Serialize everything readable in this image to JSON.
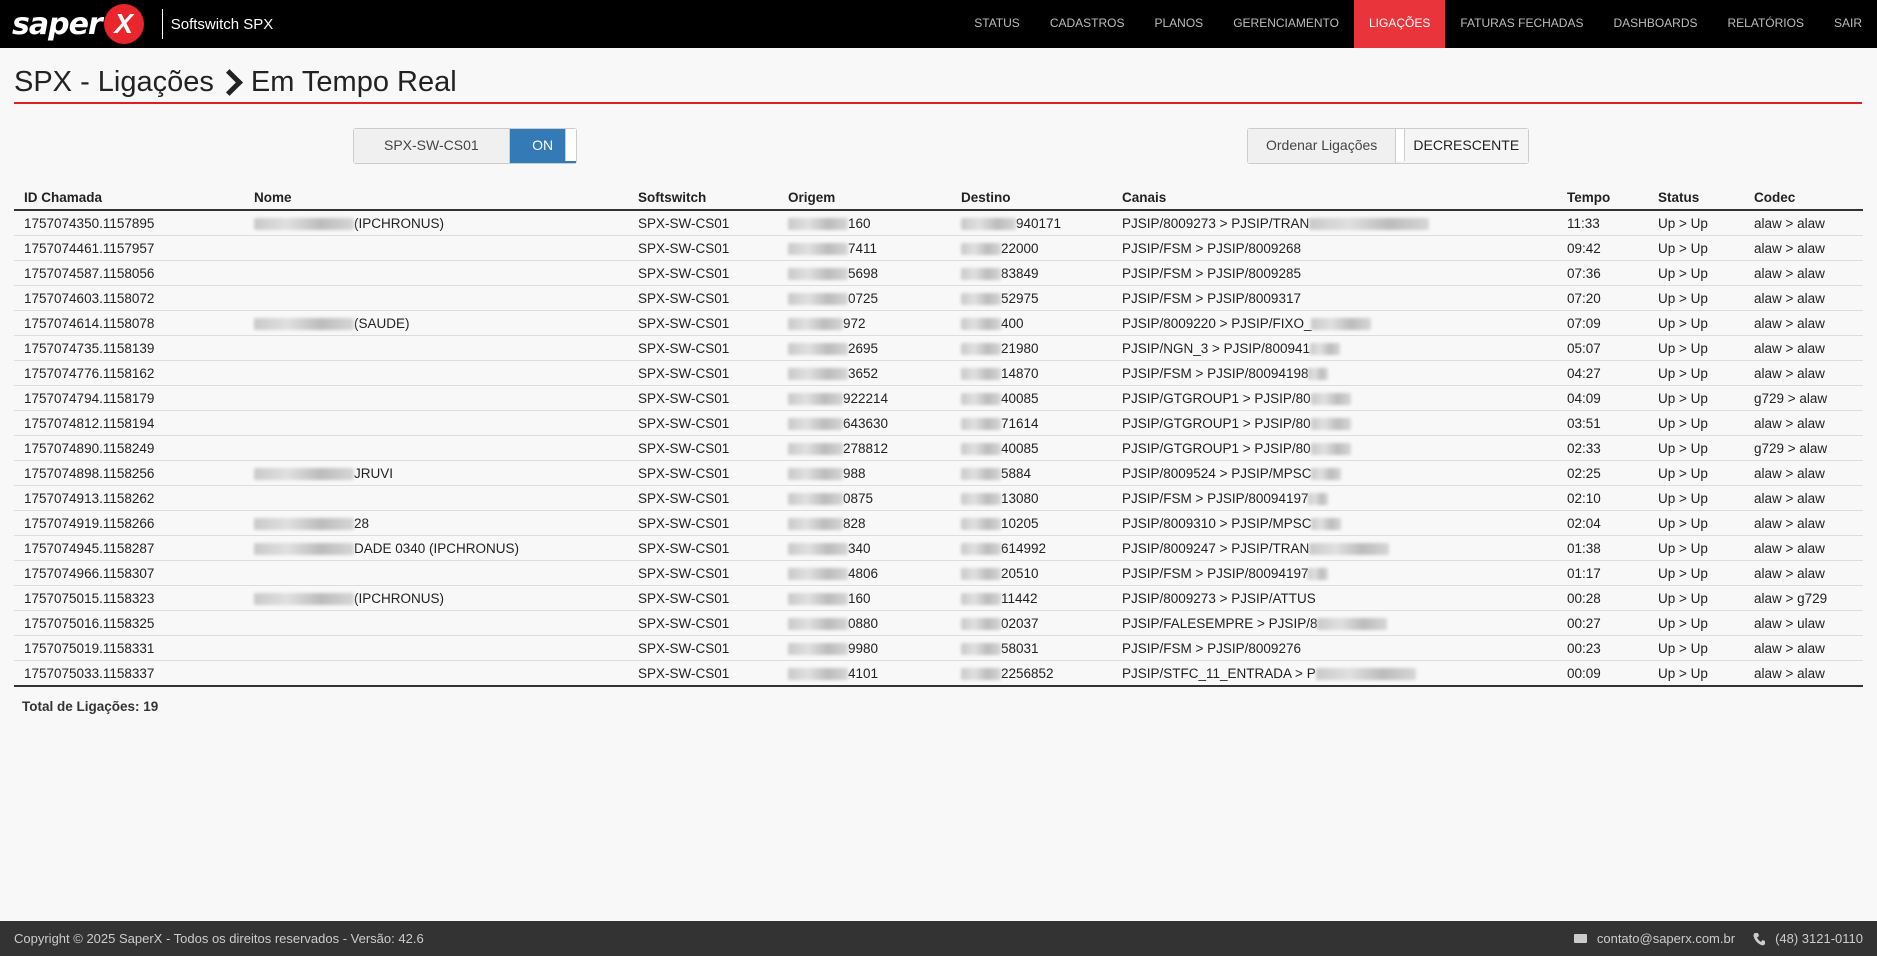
{
  "brand": {
    "logo_text": "saper",
    "logo_x": "X",
    "app_name": "Softswitch SPX"
  },
  "nav": [
    {
      "label": "STATUS"
    },
    {
      "label": "CADASTROS"
    },
    {
      "label": "PLANOS"
    },
    {
      "label": "GERENCIAMENTO"
    },
    {
      "label": "LIGAÇÕES",
      "active": true
    },
    {
      "label": "FATURAS FECHADAS"
    },
    {
      "label": "DASHBOARDS"
    },
    {
      "label": "RELATÓRIOS"
    },
    {
      "label": "SAIR"
    }
  ],
  "page": {
    "title_part1": "SPX - Ligações",
    "title_part2": "Em Tempo Real"
  },
  "switch_toggle": {
    "label": "SPX-SW-CS01",
    "state": "ON"
  },
  "order_toggle": {
    "label": "Ordenar Ligações",
    "value": "DECRESCENTE"
  },
  "table": {
    "headers": [
      "ID Chamada",
      "Nome",
      "Softswitch",
      "Origem",
      "Destino",
      "Canais",
      "Tempo",
      "Status",
      "Codec"
    ],
    "rows": [
      {
        "id": "1757074350.1157895",
        "nome": "(IPCHRONUS)",
        "nome_blur": 100,
        "soft": "SPX-SW-CS01",
        "origem": "160",
        "orig_blur": 60,
        "destino": "940171",
        "dest_blur": 55,
        "canais": "PJSIP/8009273 > PJSIP/TRAN",
        "can_blur": 120,
        "tempo": "11:33",
        "status": "Up > Up",
        "codec": "alaw > alaw"
      },
      {
        "id": "1757074461.1157957",
        "nome": "",
        "nome_blur": 0,
        "soft": "SPX-SW-CS01",
        "origem": "7411",
        "orig_blur": 60,
        "destino": "22000",
        "dest_blur": 40,
        "canais": "PJSIP/FSM > PJSIP/8009268",
        "can_blur": 0,
        "tempo": "09:42",
        "status": "Up > Up",
        "codec": "alaw > alaw"
      },
      {
        "id": "1757074587.1158056",
        "nome": "",
        "nome_blur": 0,
        "soft": "SPX-SW-CS01",
        "origem": "5698",
        "orig_blur": 60,
        "destino": "83849",
        "dest_blur": 40,
        "canais": "PJSIP/FSM > PJSIP/8009285",
        "can_blur": 0,
        "tempo": "07:36",
        "status": "Up > Up",
        "codec": "alaw > alaw"
      },
      {
        "id": "1757074603.1158072",
        "nome": "",
        "nome_blur": 0,
        "soft": "SPX-SW-CS01",
        "origem": "0725",
        "orig_blur": 60,
        "destino": "52975",
        "dest_blur": 40,
        "canais": "PJSIP/FSM > PJSIP/8009317",
        "can_blur": 0,
        "tempo": "07:20",
        "status": "Up > Up",
        "codec": "alaw > alaw"
      },
      {
        "id": "1757074614.1158078",
        "nome": "(SAUDE)",
        "nome_blur": 100,
        "soft": "SPX-SW-CS01",
        "origem": "972",
        "orig_blur": 55,
        "destino": "400",
        "dest_blur": 40,
        "canais": "PJSIP/8009220 > PJSIP/FIXO_",
        "can_blur": 60,
        "tempo": "07:09",
        "status": "Up > Up",
        "codec": "alaw > alaw"
      },
      {
        "id": "1757074735.1158139",
        "nome": "",
        "nome_blur": 0,
        "soft": "SPX-SW-CS01",
        "origem": "2695",
        "orig_blur": 60,
        "destino": "21980",
        "dest_blur": 40,
        "canais": "PJSIP/NGN_3 > PJSIP/800941",
        "can_blur": 30,
        "tempo": "05:07",
        "status": "Up > Up",
        "codec": "alaw > alaw"
      },
      {
        "id": "1757074776.1158162",
        "nome": "",
        "nome_blur": 0,
        "soft": "SPX-SW-CS01",
        "origem": "3652",
        "orig_blur": 60,
        "destino": "14870",
        "dest_blur": 40,
        "canais": "PJSIP/FSM > PJSIP/80094198",
        "can_blur": 20,
        "tempo": "04:27",
        "status": "Up > Up",
        "codec": "alaw > alaw"
      },
      {
        "id": "1757074794.1158179",
        "nome": "",
        "nome_blur": 0,
        "soft": "SPX-SW-CS01",
        "origem": "922214",
        "orig_blur": 55,
        "destino": "40085",
        "dest_blur": 40,
        "canais": "PJSIP/GTGROUP1 > PJSIP/80",
        "can_blur": 40,
        "tempo": "04:09",
        "status": "Up > Up",
        "codec": "g729 > alaw"
      },
      {
        "id": "1757074812.1158194",
        "nome": "",
        "nome_blur": 0,
        "soft": "SPX-SW-CS01",
        "origem": "643630",
        "orig_blur": 55,
        "destino": "71614",
        "dest_blur": 40,
        "canais": "PJSIP/GTGROUP1 > PJSIP/80",
        "can_blur": 40,
        "tempo": "03:51",
        "status": "Up > Up",
        "codec": "alaw > alaw"
      },
      {
        "id": "1757074890.1158249",
        "nome": "",
        "nome_blur": 0,
        "soft": "SPX-SW-CS01",
        "origem": "278812",
        "orig_blur": 55,
        "destino": "40085",
        "dest_blur": 40,
        "canais": "PJSIP/GTGROUP1 > PJSIP/80",
        "can_blur": 40,
        "tempo": "02:33",
        "status": "Up > Up",
        "codec": "g729 > alaw"
      },
      {
        "id": "1757074898.1158256",
        "nome": "JRUVI",
        "nome_blur": 100,
        "soft": "SPX-SW-CS01",
        "origem": "988",
        "orig_blur": 55,
        "destino": "5884",
        "dest_blur": 40,
        "canais": "PJSIP/8009524 > PJSIP/MPSC",
        "can_blur": 30,
        "tempo": "02:25",
        "status": "Up > Up",
        "codec": "alaw > alaw"
      },
      {
        "id": "1757074913.1158262",
        "nome": "",
        "nome_blur": 0,
        "soft": "SPX-SW-CS01",
        "origem": "0875",
        "orig_blur": 55,
        "destino": "13080",
        "dest_blur": 40,
        "canais": "PJSIP/FSM > PJSIP/80094197",
        "can_blur": 20,
        "tempo": "02:10",
        "status": "Up > Up",
        "codec": "alaw > alaw"
      },
      {
        "id": "1757074919.1158266",
        "nome": "28",
        "nome_blur": 100,
        "soft": "SPX-SW-CS01",
        "origem": "828",
        "orig_blur": 55,
        "destino": "10205",
        "dest_blur": 40,
        "canais": "PJSIP/8009310 > PJSIP/MPSC",
        "can_blur": 30,
        "tempo": "02:04",
        "status": "Up > Up",
        "codec": "alaw > alaw"
      },
      {
        "id": "1757074945.1158287",
        "nome": "DADE 0340 (IPCHRONUS)",
        "nome_blur": 100,
        "soft": "SPX-SW-CS01",
        "origem": "340",
        "orig_blur": 60,
        "destino": "614992",
        "dest_blur": 40,
        "canais": "PJSIP/8009247 > PJSIP/TRAN",
        "can_blur": 80,
        "tempo": "01:38",
        "status": "Up > Up",
        "codec": "alaw > alaw"
      },
      {
        "id": "1757074966.1158307",
        "nome": "",
        "nome_blur": 0,
        "soft": "SPX-SW-CS01",
        "origem": "4806",
        "orig_blur": 60,
        "destino": "20510",
        "dest_blur": 40,
        "canais": "PJSIP/FSM > PJSIP/80094197",
        "can_blur": 20,
        "tempo": "01:17",
        "status": "Up > Up",
        "codec": "alaw > alaw"
      },
      {
        "id": "1757075015.1158323",
        "nome": "(IPCHRONUS)",
        "nome_blur": 100,
        "soft": "SPX-SW-CS01",
        "origem": "160",
        "orig_blur": 60,
        "destino": "11442",
        "dest_blur": 40,
        "canais": "PJSIP/8009273 > PJSIP/ATTUS",
        "can_blur": 0,
        "tempo": "00:28",
        "status": "Up > Up",
        "codec": "alaw > g729"
      },
      {
        "id": "1757075016.1158325",
        "nome": "",
        "nome_blur": 0,
        "soft": "SPX-SW-CS01",
        "origem": "0880",
        "orig_blur": 60,
        "destino": "02037",
        "dest_blur": 40,
        "canais": "PJSIP/FALESEMPRE > PJSIP/8",
        "can_blur": 70,
        "tempo": "00:27",
        "status": "Up > Up",
        "codec": "alaw > ulaw"
      },
      {
        "id": "1757075019.1158331",
        "nome": "",
        "nome_blur": 0,
        "soft": "SPX-SW-CS01",
        "origem": "9980",
        "orig_blur": 60,
        "destino": "58031",
        "dest_blur": 40,
        "canais": "PJSIP/FSM > PJSIP/8009276",
        "can_blur": 0,
        "tempo": "00:23",
        "status": "Up > Up",
        "codec": "alaw > alaw"
      },
      {
        "id": "1757075033.1158337",
        "nome": "",
        "nome_blur": 0,
        "soft": "SPX-SW-CS01",
        "origem": "4101",
        "orig_blur": 60,
        "destino": "2256852",
        "dest_blur": 40,
        "canais": "PJSIP/STFC_11_ENTRADA > P",
        "can_blur": 100,
        "tempo": "00:09",
        "status": "Up > Up",
        "codec": "alaw > alaw"
      }
    ]
  },
  "total": "Total de Ligações: 19",
  "footer": {
    "copyright": "Copyright © 2025 SaperX - Todos os direitos reservados - Versão: 42.6",
    "email": "contato@saperx.com.br",
    "phone": "(48) 3121-0110"
  }
}
